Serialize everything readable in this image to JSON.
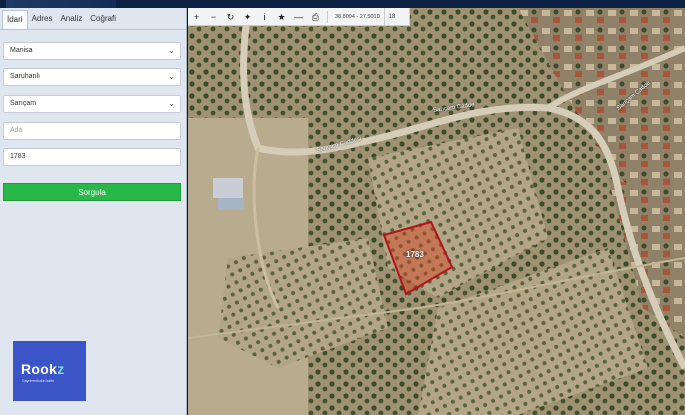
{
  "sidebar": {
    "tabs": [
      {
        "label": "İdari"
      },
      {
        "label": "Adres"
      },
      {
        "label": "Analiz"
      },
      {
        "label": "Coğrafi"
      }
    ],
    "province": "Manisa",
    "district": "Saruhanlı",
    "neighborhood": "Sarıçam",
    "ada_placeholder": "Ada",
    "parsel_value": "1783",
    "query_label": "Sorgula"
  },
  "brand": {
    "name_main": "Rook",
    "name_mark": "z",
    "tagline": "Gayrimenkulün kalbi"
  },
  "map": {
    "coords": "38.8094 - 27.5010",
    "zoom": "18",
    "road_label_1": "Sarıçam Caddesi",
    "road_label_2": "Sarıçam Cadde",
    "road_label_3": "Sarıçam Cadde",
    "parcel_label": "1783",
    "colors": {
      "parcel_outline": "#b3141b",
      "parcel_fill": "#d8431f"
    }
  },
  "toolbar": {
    "icons": [
      "zoom-in-icon",
      "zoom-out-icon",
      "refresh-icon",
      "center-icon",
      "info-icon",
      "star-icon",
      "measure-icon",
      "print-icon"
    ]
  }
}
